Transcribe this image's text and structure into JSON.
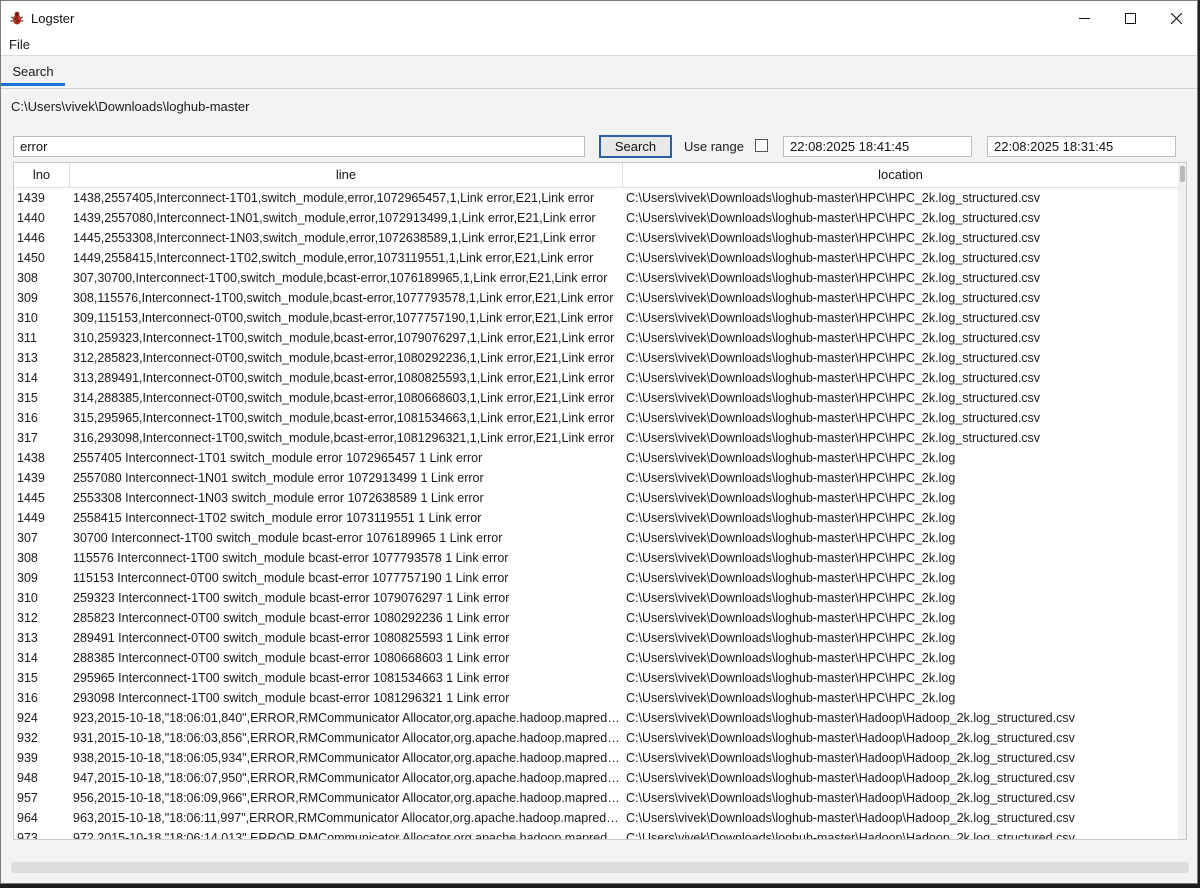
{
  "window": {
    "title": "Logster",
    "icon": "bug-icon"
  },
  "controls": {
    "minimize": "–",
    "maximize": "☐",
    "close": "✕"
  },
  "menu": {
    "file": "File"
  },
  "tabs": [
    {
      "label": "Search",
      "active": true
    }
  ],
  "path": "C:\\Users\\vivek\\Downloads\\loghub-master",
  "search": {
    "value": "error",
    "button_label": "Search"
  },
  "range": {
    "label": "Use range",
    "checked": false,
    "start": "22:08:2025 18:41:45",
    "end": "22:08:2025 18:31:45"
  },
  "columns": {
    "lno": "lno",
    "line": "line",
    "location": "location"
  },
  "rows": [
    {
      "lno": "1439",
      "line": "1438,2557405,Interconnect-1T01,switch_module,error,1072965457,1,Link error,E21,Link error",
      "location": "C:\\Users\\vivek\\Downloads\\loghub-master\\HPC\\HPC_2k.log_structured.csv"
    },
    {
      "lno": "1440",
      "line": "1439,2557080,Interconnect-1N01,switch_module,error,1072913499,1,Link error,E21,Link error",
      "location": "C:\\Users\\vivek\\Downloads\\loghub-master\\HPC\\HPC_2k.log_structured.csv"
    },
    {
      "lno": "1446",
      "line": "1445,2553308,Interconnect-1N03,switch_module,error,1072638589,1,Link error,E21,Link error",
      "location": "C:\\Users\\vivek\\Downloads\\loghub-master\\HPC\\HPC_2k.log_structured.csv"
    },
    {
      "lno": "1450",
      "line": "1449,2558415,Interconnect-1T02,switch_module,error,1073119551,1,Link error,E21,Link error",
      "location": "C:\\Users\\vivek\\Downloads\\loghub-master\\HPC\\HPC_2k.log_structured.csv"
    },
    {
      "lno": "308",
      "line": "307,30700,Interconnect-1T00,switch_module,bcast-error,1076189965,1,Link error,E21,Link error",
      "location": "C:\\Users\\vivek\\Downloads\\loghub-master\\HPC\\HPC_2k.log_structured.csv"
    },
    {
      "lno": "309",
      "line": "308,115576,Interconnect-1T00,switch_module,bcast-error,1077793578,1,Link error,E21,Link error",
      "location": "C:\\Users\\vivek\\Downloads\\loghub-master\\HPC\\HPC_2k.log_structured.csv"
    },
    {
      "lno": "310",
      "line": "309,115153,Interconnect-0T00,switch_module,bcast-error,1077757190,1,Link error,E21,Link error",
      "location": "C:\\Users\\vivek\\Downloads\\loghub-master\\HPC\\HPC_2k.log_structured.csv"
    },
    {
      "lno": "311",
      "line": "310,259323,Interconnect-1T00,switch_module,bcast-error,1079076297,1,Link error,E21,Link error",
      "location": "C:\\Users\\vivek\\Downloads\\loghub-master\\HPC\\HPC_2k.log_structured.csv"
    },
    {
      "lno": "313",
      "line": "312,285823,Interconnect-0T00,switch_module,bcast-error,1080292236,1,Link error,E21,Link error",
      "location": "C:\\Users\\vivek\\Downloads\\loghub-master\\HPC\\HPC_2k.log_structured.csv"
    },
    {
      "lno": "314",
      "line": "313,289491,Interconnect-0T00,switch_module,bcast-error,1080825593,1,Link error,E21,Link error",
      "location": "C:\\Users\\vivek\\Downloads\\loghub-master\\HPC\\HPC_2k.log_structured.csv"
    },
    {
      "lno": "315",
      "line": "314,288385,Interconnect-0T00,switch_module,bcast-error,1080668603,1,Link error,E21,Link error",
      "location": "C:\\Users\\vivek\\Downloads\\loghub-master\\HPC\\HPC_2k.log_structured.csv"
    },
    {
      "lno": "316",
      "line": "315,295965,Interconnect-1T00,switch_module,bcast-error,1081534663,1,Link error,E21,Link error",
      "location": "C:\\Users\\vivek\\Downloads\\loghub-master\\HPC\\HPC_2k.log_structured.csv"
    },
    {
      "lno": "317",
      "line": "316,293098,Interconnect-1T00,switch_module,bcast-error,1081296321,1,Link error,E21,Link error",
      "location": "C:\\Users\\vivek\\Downloads\\loghub-master\\HPC\\HPC_2k.log_structured.csv"
    },
    {
      "lno": "1438",
      "line": "2557405 Interconnect-1T01 switch_module error 1072965457 1 Link error",
      "location": "C:\\Users\\vivek\\Downloads\\loghub-master\\HPC\\HPC_2k.log"
    },
    {
      "lno": "1439",
      "line": "2557080 Interconnect-1N01 switch_module error 1072913499 1 Link error",
      "location": "C:\\Users\\vivek\\Downloads\\loghub-master\\HPC\\HPC_2k.log"
    },
    {
      "lno": "1445",
      "line": "2553308 Interconnect-1N03 switch_module error 1072638589 1 Link error",
      "location": "C:\\Users\\vivek\\Downloads\\loghub-master\\HPC\\HPC_2k.log"
    },
    {
      "lno": "1449",
      "line": "2558415 Interconnect-1T02 switch_module error 1073119551 1 Link error",
      "location": "C:\\Users\\vivek\\Downloads\\loghub-master\\HPC\\HPC_2k.log"
    },
    {
      "lno": "307",
      "line": "30700 Interconnect-1T00 switch_module bcast-error 1076189965 1 Link error",
      "location": "C:\\Users\\vivek\\Downloads\\loghub-master\\HPC\\HPC_2k.log"
    },
    {
      "lno": "308",
      "line": "115576 Interconnect-1T00 switch_module bcast-error 1077793578 1 Link error",
      "location": "C:\\Users\\vivek\\Downloads\\loghub-master\\HPC\\HPC_2k.log"
    },
    {
      "lno": "309",
      "line": "115153 Interconnect-0T00 switch_module bcast-error 1077757190 1 Link error",
      "location": "C:\\Users\\vivek\\Downloads\\loghub-master\\HPC\\HPC_2k.log"
    },
    {
      "lno": "310",
      "line": "259323 Interconnect-1T00 switch_module bcast-error 1079076297 1 Link error",
      "location": "C:\\Users\\vivek\\Downloads\\loghub-master\\HPC\\HPC_2k.log"
    },
    {
      "lno": "312",
      "line": "285823 Interconnect-0T00 switch_module bcast-error 1080292236 1 Link error",
      "location": "C:\\Users\\vivek\\Downloads\\loghub-master\\HPC\\HPC_2k.log"
    },
    {
      "lno": "313",
      "line": "289491 Interconnect-0T00 switch_module bcast-error 1080825593 1 Link error",
      "location": "C:\\Users\\vivek\\Downloads\\loghub-master\\HPC\\HPC_2k.log"
    },
    {
      "lno": "314",
      "line": "288385 Interconnect-0T00 switch_module bcast-error 1080668603 1 Link error",
      "location": "C:\\Users\\vivek\\Downloads\\loghub-master\\HPC\\HPC_2k.log"
    },
    {
      "lno": "315",
      "line": "295965 Interconnect-1T00 switch_module bcast-error 1081534663 1 Link error",
      "location": "C:\\Users\\vivek\\Downloads\\loghub-master\\HPC\\HPC_2k.log"
    },
    {
      "lno": "316",
      "line": "293098 Interconnect-1T00 switch_module bcast-error 1081296321 1 Link error",
      "location": "C:\\Users\\vivek\\Downloads\\loghub-master\\HPC\\HPC_2k.log"
    },
    {
      "lno": "924",
      "line": "923,2015-10-18,\"18:06:01,840\",ERROR,RMCommunicator Allocator,org.apache.hadoop.mapreduce",
      "location": "C:\\Users\\vivek\\Downloads\\loghub-master\\Hadoop\\Hadoop_2k.log_structured.csv"
    },
    {
      "lno": "932",
      "line": "931,2015-10-18,\"18:06:03,856\",ERROR,RMCommunicator Allocator,org.apache.hadoop.mapreduce",
      "location": "C:\\Users\\vivek\\Downloads\\loghub-master\\Hadoop\\Hadoop_2k.log_structured.csv"
    },
    {
      "lno": "939",
      "line": "938,2015-10-18,\"18:06:05,934\",ERROR,RMCommunicator Allocator,org.apache.hadoop.mapreduce",
      "location": "C:\\Users\\vivek\\Downloads\\loghub-master\\Hadoop\\Hadoop_2k.log_structured.csv"
    },
    {
      "lno": "948",
      "line": "947,2015-10-18,\"18:06:07,950\",ERROR,RMCommunicator Allocator,org.apache.hadoop.mapreduce",
      "location": "C:\\Users\\vivek\\Downloads\\loghub-master\\Hadoop\\Hadoop_2k.log_structured.csv"
    },
    {
      "lno": "957",
      "line": "956,2015-10-18,\"18:06:09,966\",ERROR,RMCommunicator Allocator,org.apache.hadoop.mapreduce",
      "location": "C:\\Users\\vivek\\Downloads\\loghub-master\\Hadoop\\Hadoop_2k.log_structured.csv"
    },
    {
      "lno": "964",
      "line": "963,2015-10-18,\"18:06:11,997\",ERROR,RMCommunicator Allocator,org.apache.hadoop.mapreduce",
      "location": "C:\\Users\\vivek\\Downloads\\loghub-master\\Hadoop\\Hadoop_2k.log_structured.csv"
    },
    {
      "lno": "973",
      "line": "972,2015-10-18,\"18:06:14,013\",ERROR,RMCommunicator Allocator,org.apache.hadoop.mapreduce",
      "location": "C:\\Users\\vivek\\Downloads\\loghub-master\\Hadoop\\Hadoop_2k.log_structured.csv"
    }
  ],
  "colors": {
    "accent": "#1a73d9",
    "button_border": "#2c5f9e"
  }
}
